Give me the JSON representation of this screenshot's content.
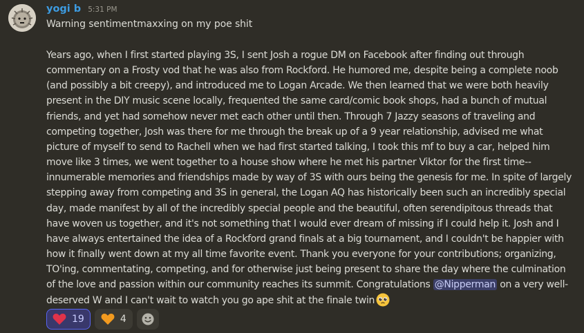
{
  "message": {
    "username": "yogi b",
    "timestamp": "5:31 PM",
    "first_line": "Warning sentimentmaxxing on my poe shit",
    "body_before_mention": "Years ago, when I first started playing 3S, I sent Josh a rogue DM on Facebook after finding out through commentary on a Frosty vod that he was also from Rockford. He humored me, despite being a complete noob (and possibly a bit creepy), and introduced me to Logan Arcade. We then learned that we were both heavily present in the DIY music scene locally, frequented the same card/comic book shops, had a bunch of mutual friends, and yet had somehow never met each other until then. Through 7 Jazzy seasons of traveling and competing together, Josh was there for me through the break up of a 9 year relationship, advised me what picture of myself to send to Rachell when we had first started talking, I took this mf to buy a car, helped him move like 3 times, we went together to a house show where he met his partner Viktor for the first time--innumerable memories and friendships made by way of 3S with ours being the genesis for me. In spite of largely stepping away from competing and 3S in general, the Logan AQ has historically been such an incredibly special day, made manifest by all of the incredibly special people and the beautiful, often serendipitous threads that have woven us together, and it's not something that I would ever dream of missing if I could help it. Josh and I have always entertained the idea of a Rockford grand finals at a big tournament, and I couldn't be happier with how it finally went down at my all time favorite event. Thank you everyone for your contributions; organizing, TO'ing, commentating, competing, and for otherwise just being present to share the day where the culmination of the love and passion within our community reaches its summit. Congratulations ",
    "mention": "@Nipperman",
    "body_after_mention": " on a very well-deserved W and I can't wait to watch you go ape shit at the finale twin",
    "end_emoji": "pleading-face-emoji"
  },
  "reactions": [
    {
      "emoji": "red-heart",
      "count": "19",
      "active": true,
      "color": "#e0334a"
    },
    {
      "emoji": "orange-heart",
      "count": "4",
      "active": false,
      "color": "#f29a1f"
    }
  ],
  "colors": {
    "background": "#2f2d27",
    "username": "#3d9be0",
    "mention_bg": "#3c3f68",
    "active_reaction_border": "#5865f2"
  }
}
